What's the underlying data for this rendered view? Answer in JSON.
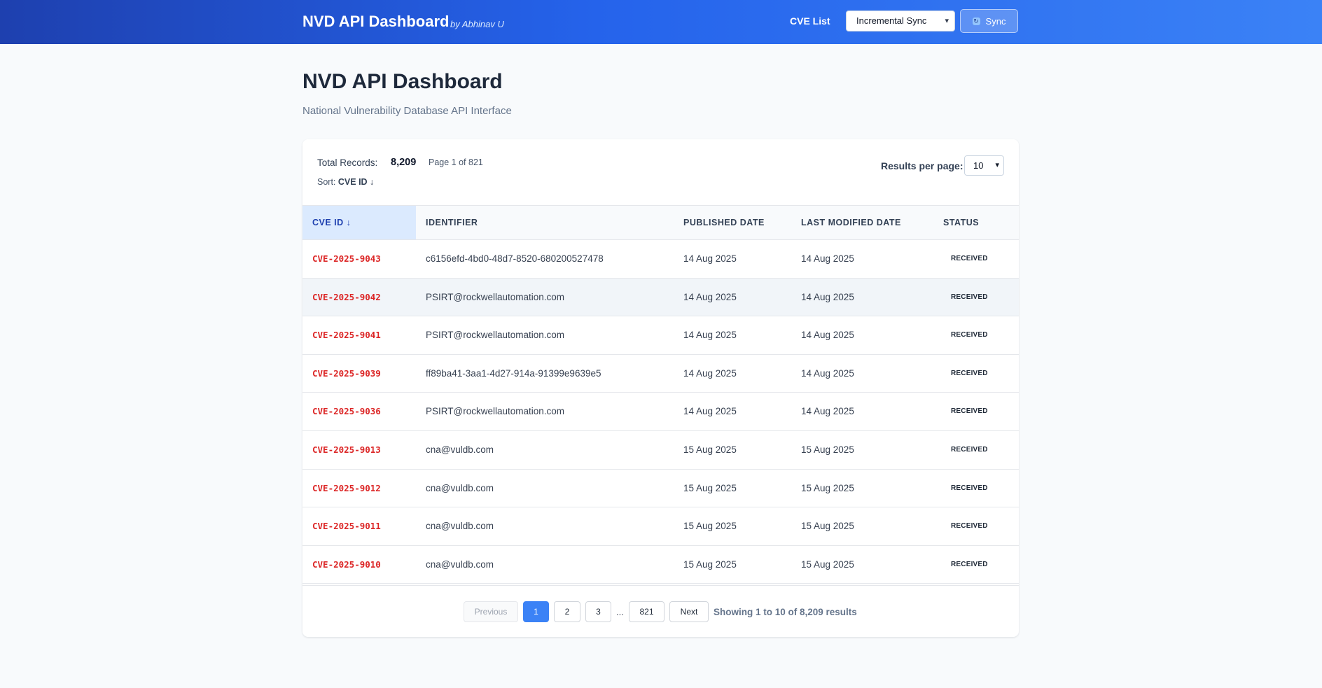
{
  "header": {
    "brand": "NVD API Dashboard",
    "brand_sub": "by Abhinav U",
    "nav_link": "CVE List",
    "sync_mode": "Incremental Sync",
    "sync_label": "Sync"
  },
  "page": {
    "title": "NVD API Dashboard",
    "subtitle": "National Vulnerability Database API Interface"
  },
  "meta": {
    "total_label": "Total Records:",
    "total_value": "8,209",
    "page_info": "Page 1 of 821",
    "sort_label": "Sort:",
    "sort_value": "CVE ID ↓",
    "rpp_label": "Results per page:",
    "rpp_value": "10"
  },
  "table": {
    "columns": [
      "CVE ID ↓",
      "IDENTIFIER",
      "PUBLISHED DATE",
      "LAST MODIFIED DATE",
      "STATUS"
    ],
    "rows": [
      {
        "id": "CVE-2025-9043",
        "identifier": "c6156efd-4bd0-48d7-8520-680200527478",
        "published": "14 Aug 2025",
        "modified": "14 Aug 2025",
        "status": "RECEIVED"
      },
      {
        "id": "CVE-2025-9042",
        "identifier": "PSIRT@rockwellautomation.com",
        "published": "14 Aug 2025",
        "modified": "14 Aug 2025",
        "status": "RECEIVED"
      },
      {
        "id": "CVE-2025-9041",
        "identifier": "PSIRT@rockwellautomation.com",
        "published": "14 Aug 2025",
        "modified": "14 Aug 2025",
        "status": "RECEIVED"
      },
      {
        "id": "CVE-2025-9039",
        "identifier": "ff89ba41-3aa1-4d27-914a-91399e9639e5",
        "published": "14 Aug 2025",
        "modified": "14 Aug 2025",
        "status": "RECEIVED"
      },
      {
        "id": "CVE-2025-9036",
        "identifier": "PSIRT@rockwellautomation.com",
        "published": "14 Aug 2025",
        "modified": "14 Aug 2025",
        "status": "RECEIVED"
      },
      {
        "id": "CVE-2025-9013",
        "identifier": "cna@vuldb.com",
        "published": "15 Aug 2025",
        "modified": "15 Aug 2025",
        "status": "RECEIVED"
      },
      {
        "id": "CVE-2025-9012",
        "identifier": "cna@vuldb.com",
        "published": "15 Aug 2025",
        "modified": "15 Aug 2025",
        "status": "RECEIVED"
      },
      {
        "id": "CVE-2025-9011",
        "identifier": "cna@vuldb.com",
        "published": "15 Aug 2025",
        "modified": "15 Aug 2025",
        "status": "RECEIVED"
      },
      {
        "id": "CVE-2025-9010",
        "identifier": "cna@vuldb.com",
        "published": "15 Aug 2025",
        "modified": "15 Aug 2025",
        "status": "RECEIVED"
      }
    ]
  },
  "pagination": {
    "previous": "Previous",
    "pages": [
      "1",
      "2",
      "3"
    ],
    "ellipsis": "...",
    "last_page": "821",
    "next": "Next",
    "info": "Showing 1 to 10 of 8,209 results"
  },
  "icons": {
    "sync": "sync-icon",
    "dropdown": "chevron-down-icon"
  },
  "colors": {
    "accent": "#3b82f6",
    "cve_id": "#dc2626",
    "header_start": "#1e40af",
    "header_end": "#3b82f6"
  }
}
